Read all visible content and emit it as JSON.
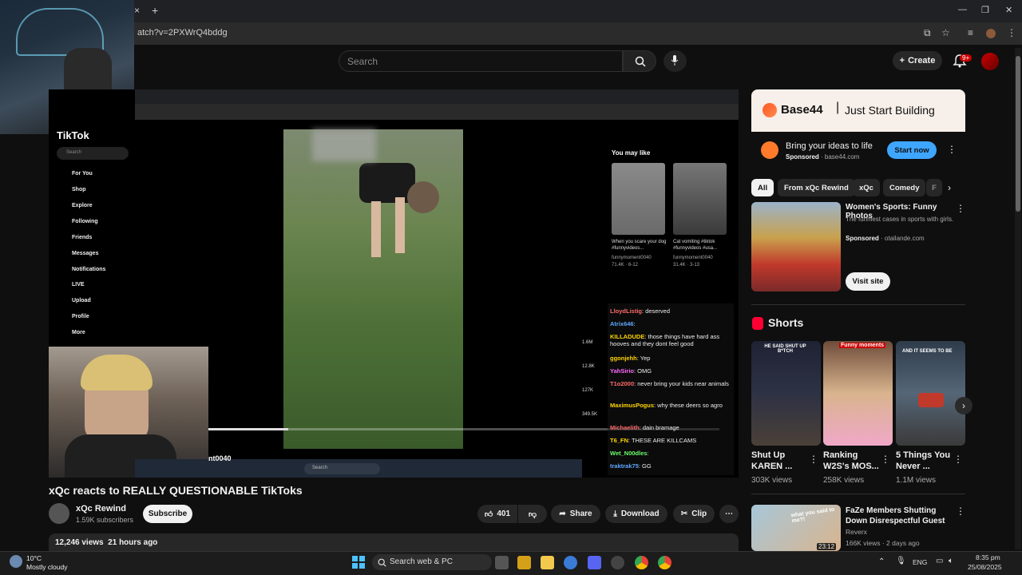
{
  "browser": {
    "url": "atch?v=2PXWrQ4bddg",
    "new_tab": "+",
    "close_tab": "×"
  },
  "header": {
    "search_placeholder": "Search",
    "create_label": "Create",
    "notifications_badge": "9+"
  },
  "video_content": {
    "tiktok_logo": "TikTok",
    "tiktok_search": "Search",
    "tiktok_nav": [
      "For You",
      "Shop",
      "Explore",
      "Following",
      "Friends",
      "Messages",
      "Notifications",
      "LIVE",
      "Upload",
      "Profile",
      "More"
    ],
    "you_may_like": "You may like",
    "suggestions": [
      {
        "caption": "When you scare your dog #funnyvideos...",
        "author": "funnymoment0040",
        "stats": "71.4K · 6-12"
      },
      {
        "caption": "Cat vomiting #tiktok #funnyvideos #usa...",
        "author": "funnymoment0040",
        "stats": "31.4K · 3-13"
      }
    ],
    "side_stats": [
      "1.6M",
      "12.8K",
      "127K",
      "349.5K"
    ],
    "taskbar_search": "Search",
    "watermark_partial": "nt0040",
    "chat": [
      {
        "name": "LloydListig",
        "text": ": deserved",
        "color": "#ff6b6b"
      },
      {
        "name": "Atrix646",
        "text": ":",
        "color": "#5fa8ff"
      },
      {
        "name": "KILLADUDE",
        "text": ": those things have hard ass hooves and they dont feel good",
        "color": "#ffd400"
      },
      {
        "name": "ggonjehh",
        "text": ": Yep",
        "color": "#ffd400"
      },
      {
        "name": "YahSirio",
        "text": ": OMG",
        "color": "#ff6bff"
      },
      {
        "name": "T1o2000",
        "text": ": never bring your kids near animals",
        "color": "#ff6b6b"
      },
      {
        "name": "MaximusPogus",
        "text": ": why these deers so agro",
        "color": "#ffd400"
      },
      {
        "name": "Michaelith",
        "text": ": dain bramage",
        "color": "#ff6b6b"
      },
      {
        "name": "T6_FN",
        "text": ": THESE ARE KILLCAMS",
        "color": "#ffd400"
      },
      {
        "name": "Wet_N00dles",
        "text": ":",
        "color": "#6bff6b"
      },
      {
        "name": "traktrak75",
        "text": ": GG",
        "color": "#5fa8ff"
      }
    ]
  },
  "video": {
    "title": "xQc reacts to REALLY QUESTIONABLE TikToks",
    "channel": "xQc Rewind",
    "subscribers": "1.59K subscribers",
    "subscribe_label": "Subscribe",
    "likes": "401",
    "share_label": "Share",
    "download_label": "Download",
    "clip_label": "Clip",
    "views": "12,246 views",
    "age": "21 hours ago"
  },
  "sidebar": {
    "ad": {
      "brand": "Base44",
      "tagline": "Just Start Building",
      "headline": "Bring your ideas to life",
      "sponsored": "Sponsored",
      "domain": "base44.com",
      "cta": "Start now"
    },
    "chips": [
      "All",
      "From xQc Rewind",
      "xQc",
      "Comedy",
      "F"
    ],
    "ad2": {
      "title": "Women's Sports: Funny Photos",
      "desc": "The funniest cases in sports with girls.",
      "sponsored": "Sponsored",
      "domain": "otailande.com",
      "cta": "Visit site"
    },
    "shorts_header": "Shorts",
    "shorts": [
      {
        "title": "Shut Up KAREN ...",
        "views": "303K views",
        "overlay": "HE SAID SHUT UP B*TCH"
      },
      {
        "title": "Ranking W2S's MOS...",
        "views": "258K views",
        "overlay": "Funny moments"
      },
      {
        "title": "5 Things You Never ...",
        "views": "1.1M views",
        "overlay": "AND IT SEEMS TO BE"
      }
    ],
    "rec": {
      "title": "FaZe Members Shutting Down Disrespectful Guest",
      "channel": "Reverx",
      "meta": "166K views · 2 days ago",
      "duration": "23:12",
      "thumb_text": "what you said to me?!"
    }
  },
  "taskbar": {
    "weather_temp": "10°C",
    "weather_desc": "Mostly cloudy",
    "search_label": "Search web & PC",
    "lang": "ENG",
    "time": "8:35 pm",
    "date": "25/08/2025"
  }
}
